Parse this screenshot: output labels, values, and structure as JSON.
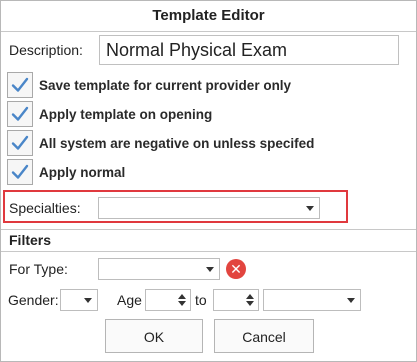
{
  "window": {
    "title": "Template Editor"
  },
  "description": {
    "label": "Description:",
    "value": "Normal Physical Exam"
  },
  "options": [
    {
      "label": "Save template for current provider only",
      "checked": true
    },
    {
      "label": "Apply template on opening",
      "checked": true
    },
    {
      "label": "All system are negative on unless specifed",
      "checked": true
    },
    {
      "label": "Apply normal",
      "checked": true
    }
  ],
  "specialties": {
    "label": "Specialties:",
    "value": ""
  },
  "filters": {
    "title": "Filters",
    "for_type_label": "For Type:",
    "for_type_value": "",
    "gender_label": "Gender:",
    "gender_value": "",
    "age_label": "Age",
    "to_label": "to",
    "age_from": "",
    "age_to": "",
    "age_unit": ""
  },
  "buttons": {
    "ok": "OK",
    "cancel": "Cancel"
  },
  "colors": {
    "highlight": "#e0393e",
    "check": "#4a86c8",
    "clear": "#e2453f"
  }
}
